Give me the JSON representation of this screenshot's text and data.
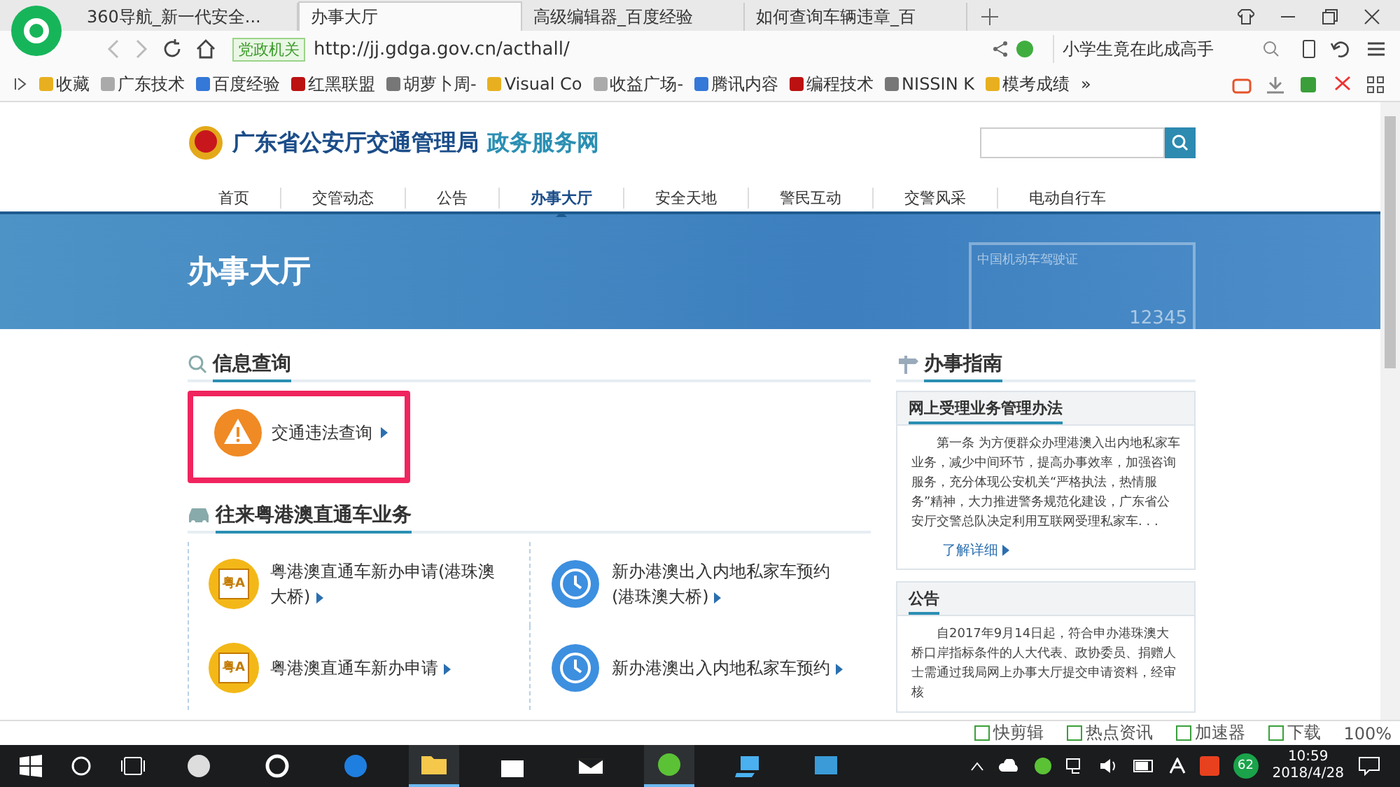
{
  "browser": {
    "tabs": [
      {
        "label": "360导航_新一代安全...",
        "selected": false
      },
      {
        "label": "办事大厅",
        "selected": true
      },
      {
        "label": "高级编辑器_百度经验",
        "selected": false
      },
      {
        "label": "如何查询车辆违章_百",
        "selected": false
      }
    ],
    "address": {
      "badge": "党政机关",
      "url": "http://jj.gdga.gov.cn/acthall/"
    },
    "search_hint": "小学生竟在此成高手",
    "bookmarks": [
      "收藏",
      "广东技术",
      "百度经验",
      "红黑联盟",
      "胡萝卜周-",
      "Visual Co",
      "收益广场-",
      "腾讯内容",
      "编程技术",
      "NISSIN K",
      "模考成绩"
    ],
    "bookmarks_more": "»"
  },
  "site": {
    "title": "广东省公安厅交通管理局",
    "subtitle": "政务服务网",
    "nav": [
      {
        "label": "首页",
        "selected": false
      },
      {
        "label": "交管动态",
        "selected": false
      },
      {
        "label": "公告",
        "selected": false
      },
      {
        "label": "办事大厅",
        "selected": true
      },
      {
        "label": "安全天地",
        "selected": false
      },
      {
        "label": "警民互动",
        "selected": false
      },
      {
        "label": "交警风采",
        "selected": false
      },
      {
        "label": "电动自行车",
        "selected": false
      }
    ],
    "banner_title": "办事大厅",
    "banner_card_text": "中国机动车驾驶证",
    "banner_card_number": "12345",
    "info_section": {
      "title": "信息查询",
      "items": [
        {
          "label": "交通违法查询",
          "highlighted": true
        }
      ]
    },
    "hk_section": {
      "title": "往来粤港澳直通车业务",
      "items": [
        {
          "kind": "plate",
          "plate": "粤A",
          "label": "粤港澳直通车新办申请(港珠澳大桥)"
        },
        {
          "kind": "clock",
          "label": "新办港澳出入内地私家车预约(港珠澳大桥)"
        },
        {
          "kind": "plate",
          "plate": "粤A",
          "label": "粤港澳直通车新办申请"
        },
        {
          "kind": "clock",
          "label": "新办港澳出入内地私家车预约"
        }
      ]
    },
    "guide": {
      "title": "办事指南",
      "panels": [
        {
          "heading": "网上受理业务管理办法",
          "text": "第一条  为方便群众办理港澳入出内地私家车业务，减少中间环节，提高办事效率，加强咨询服务，充分体现公安机关“严格执法，热情服务”精神，大力推进警务规范化建设，广东省公安厅交警总队决定利用互联网受理私家车. . .",
          "link": "了解详细"
        },
        {
          "heading": "公告",
          "text": "自2017年9月14日起，符合申办港珠澳大桥口岸指标条件的人大代表、政协委员、捐赠人士需通过我局网上办事大厅提交申请资料，经审核"
        }
      ]
    }
  },
  "status_bar": {
    "items": [
      "快剪辑",
      "热点资讯",
      "加速器",
      "下载"
    ],
    "zoom": "100%"
  },
  "taskbar": {
    "apps": [
      {
        "kind": "fan",
        "active": false
      },
      {
        "kind": "ie",
        "active": false
      },
      {
        "kind": "edge",
        "active": false
      },
      {
        "kind": "folder",
        "active": true
      },
      {
        "kind": "store",
        "active": false
      },
      {
        "kind": "mail",
        "active": false
      },
      {
        "kind": "browser",
        "active": true
      },
      {
        "kind": "computer",
        "active": false
      },
      {
        "kind": "picture",
        "active": false
      }
    ],
    "tray_badge": "62",
    "time": "10:59",
    "date": "2018/4/28"
  }
}
